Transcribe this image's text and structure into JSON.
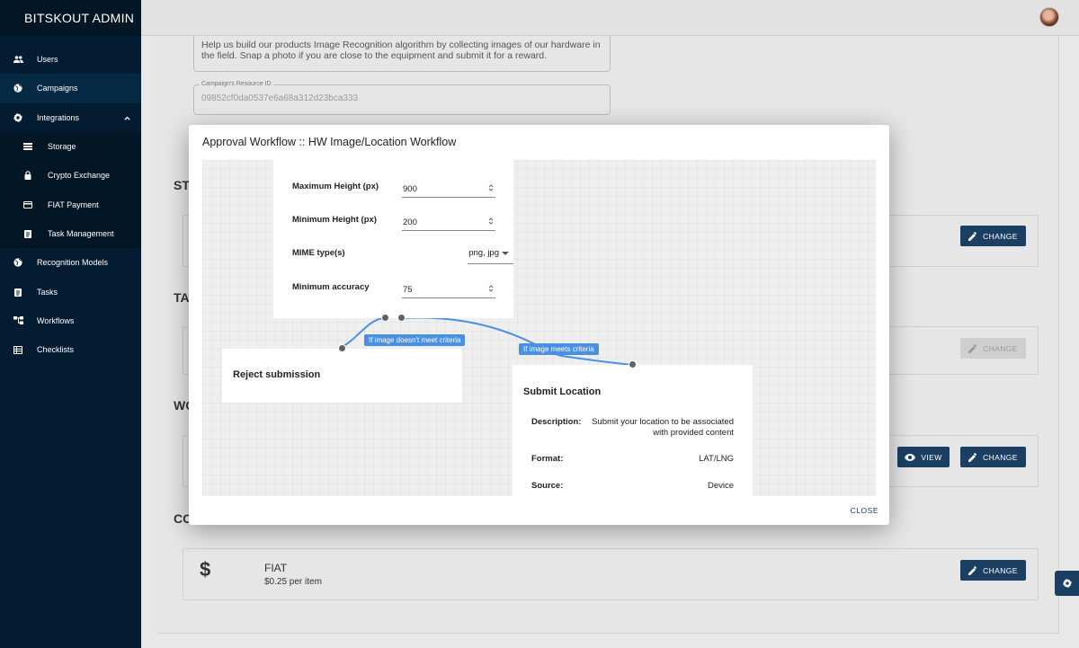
{
  "sidebar": {
    "brand": "BITSKOUT ADMIN",
    "items": [
      {
        "label": "Users",
        "icon": "users-icon"
      },
      {
        "label": "Campaigns",
        "icon": "globe-icon"
      },
      {
        "label": "Integrations",
        "icon": "gear-icon"
      },
      {
        "label": "Storage",
        "icon": "storage-icon"
      },
      {
        "label": "Crypto Exchange",
        "icon": "lock-icon"
      },
      {
        "label": "FIAT Payment",
        "icon": "card-icon"
      },
      {
        "label": "Task Management",
        "icon": "clipboard-icon"
      },
      {
        "label": "Recognition Models",
        "icon": "globe-icon"
      },
      {
        "label": "Tasks",
        "icon": "clipboard-icon"
      },
      {
        "label": "Workflows",
        "icon": "workflow-icon"
      },
      {
        "label": "Checklists",
        "icon": "table-icon"
      }
    ]
  },
  "background": {
    "description": "Help us build our products Image Recognition algorithm by collecting images of our hardware in the field. Snap a photo if you are close to the equipment and submit it for a reward.",
    "resource_label": "Campaign's Resource ID",
    "resource_id": "09852cf0da0537e6a68a312d23bca333",
    "sections": [
      "ST",
      "TA",
      "WO",
      "CO"
    ],
    "change_label": "CHANGE",
    "view_label": "VIEW",
    "fiat": {
      "icon": "$",
      "name": "FIAT",
      "price": "$0.25 per item"
    }
  },
  "modal": {
    "title": "Approval Workflow :: HW Image/Location Workflow",
    "close_label": "CLOSE",
    "criteria": [
      {
        "label": "Maximum Height (px)",
        "value": "900"
      },
      {
        "label": "Minimum Height (px)",
        "value": "200"
      },
      {
        "label": "MIME type(s)",
        "value": "png, jpg"
      },
      {
        "label": "Minimum accuracy",
        "value": "75"
      }
    ],
    "edge_fail": "If image doesn't meet criteria",
    "edge_pass": "If image meets criteria",
    "reject_title": "Reject submission",
    "submit": {
      "title": "Submit Location",
      "fields": [
        {
          "key": "Description:",
          "value": "Submit your location to be associated with provided content"
        },
        {
          "key": "Format:",
          "value": "LAT/LNG"
        },
        {
          "key": "Source:",
          "value": "Device"
        }
      ]
    }
  }
}
